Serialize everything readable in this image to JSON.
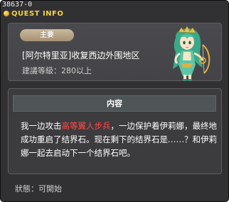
{
  "window": {
    "id_tag": "38637-0",
    "title": "QUEST INFO",
    "title_icon": "gold-orb-icon"
  },
  "summary": {
    "badge_label": "主要",
    "quest_title": "[阿尔特里亚]收复西边外围地区",
    "level_label": "建議等級：280以上",
    "npc_icon": "green-haired-npc-portrait"
  },
  "content": {
    "header_label": "内容",
    "desc_part1": "我一边攻击",
    "desc_highlight": "高等翼人步兵",
    "desc_part2": "，一边保护着伊莉娜，最终地成功重启了结界石。现在剩下的结界石是……？和伊莉娜一起去启动下一个结界石吧。"
  },
  "status": {
    "label": "狀態：",
    "value": "可開始"
  },
  "colors": {
    "window_bg": "#313134",
    "title_gold": "#f0d24a",
    "highlight_red": "#ff4a4a",
    "badge_tan": "#b8a686",
    "header_bg": "#4f5457"
  }
}
